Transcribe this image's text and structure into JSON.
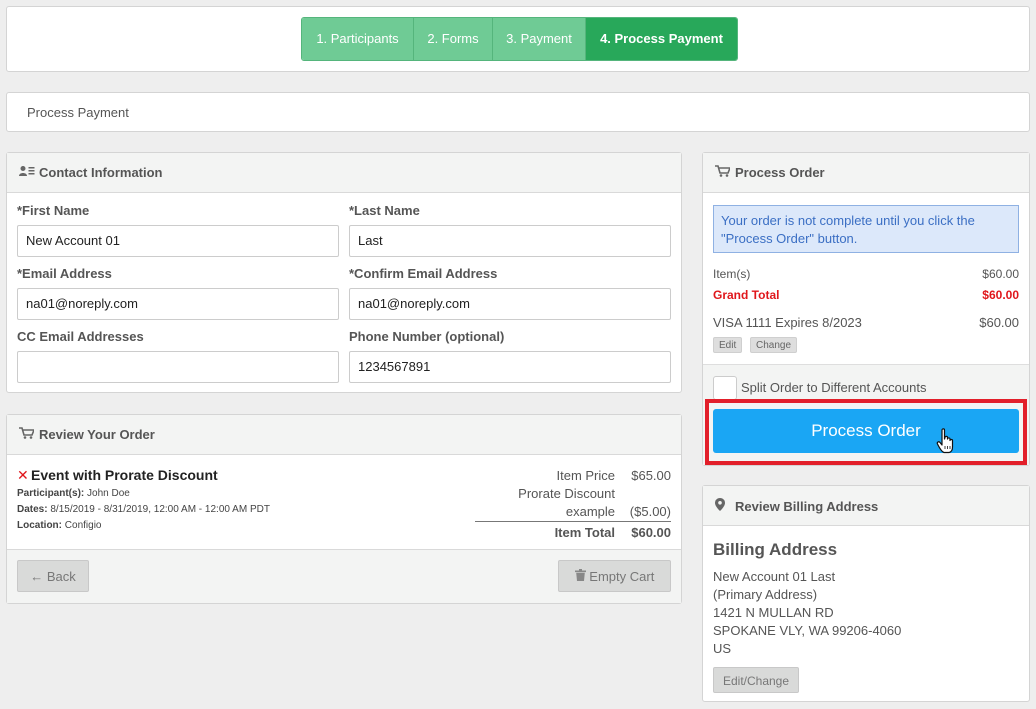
{
  "steps": [
    {
      "label": "1. Participants"
    },
    {
      "label": "2. Forms"
    },
    {
      "label": "3. Payment"
    },
    {
      "label": "4. Process Payment"
    }
  ],
  "breadcrumb": {
    "label": "Process Payment"
  },
  "contact": {
    "title": "Contact Information",
    "first_name": {
      "label": "*First Name",
      "value": "New Account 01"
    },
    "last_name": {
      "label": "*Last Name",
      "value": "Last"
    },
    "email": {
      "label": "*Email Address",
      "value": "na01@noreply.com"
    },
    "confirm_email": {
      "label": "*Confirm Email Address",
      "value": "na01@noreply.com"
    },
    "cc_email": {
      "label": "CC Email Addresses",
      "value": ""
    },
    "phone": {
      "label": "Phone Number (optional)",
      "value": "1234567891"
    }
  },
  "review": {
    "title": "Review Your Order",
    "item": {
      "name": "Event with Prorate Discount",
      "participants_label": "Participant(s):",
      "participants_value": "John Doe",
      "dates_label": "Dates:",
      "dates_value": "8/15/2019 - 8/31/2019, 12:00 AM - 12:00 AM PDT",
      "location_label": "Location:",
      "location_value": "Configio",
      "item_price_label": "Item Price",
      "item_price_value": "$65.00",
      "discount_label_1": "Prorate Discount",
      "discount_label_2": "example",
      "discount_value": "($5.00)",
      "item_total_label": "Item Total",
      "item_total_value": "$60.00"
    },
    "back_label": "Back",
    "empty_cart_label": "Empty Cart"
  },
  "process": {
    "title": "Process Order",
    "notice": "Your order is not complete until you click the \"Process Order\" button.",
    "items_label": "Item(s)",
    "items_value": "$60.00",
    "grand_total_label": "Grand Total",
    "grand_total_value": "$60.00",
    "card_label": "VISA 1111 Expires 8/2023",
    "card_value": "$60.00",
    "edit_label": "Edit",
    "change_label": "Change",
    "split_label": "Split Order to Different Accounts",
    "button_label": "Process Order"
  },
  "billing": {
    "header": "Review Billing Address",
    "title": "Billing Address",
    "lines": [
      "New Account 01 Last",
      "(Primary Address)",
      "1421 N MULLAN RD",
      "SPOKANE VLY, WA 99206-4060",
      "US"
    ],
    "edit_label": "Edit/Change"
  },
  "colors": {
    "step_inactive": "#6fcb95",
    "step_active": "#28a85a",
    "primary_button": "#1aa6f4",
    "grand_total": "#e0161b",
    "highlight_border": "#e21f2a"
  }
}
